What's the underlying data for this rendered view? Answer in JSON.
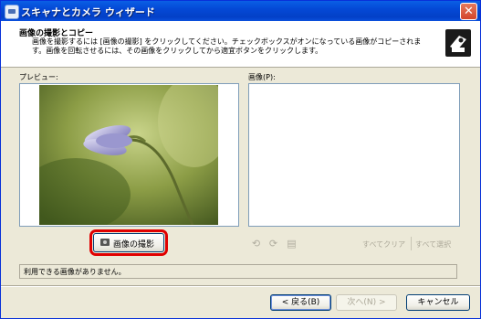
{
  "window": {
    "title": "スキャナとカメラ ウィザード",
    "close_glyph": "✕"
  },
  "header": {
    "title": "画像の撮影とコピー",
    "description": "画像を撮影するには [画像の撮影] をクリックしてください。チェックボックスがオンになっている画像がコピーされます。画像を回転させるには、その画像をクリックしてから適宜ボタンをクリックします。",
    "icon": "camera-wizard-icon"
  },
  "preview": {
    "label": "プレビュー:"
  },
  "images": {
    "label": "画像(P):"
  },
  "capture_button": {
    "label": "画像の撮影",
    "icon": "camera-icon",
    "highlight_color": "#e00000"
  },
  "toolbar": {
    "rotate_left_icon": "rotate-left-icon",
    "rotate_right_icon": "rotate-right-icon",
    "properties_icon": "properties-icon",
    "clear_all": "すべてクリア",
    "select_all": "すべて選択"
  },
  "status": {
    "text": "利用できる画像がありません。"
  },
  "buttons": {
    "back": "< 戻る(B)",
    "next": "次へ(N) >",
    "cancel": "キャンセル"
  },
  "colors": {
    "titlebar": "#0449d6",
    "dialog_bg": "#ece9d8",
    "highlight": "#e00000"
  }
}
